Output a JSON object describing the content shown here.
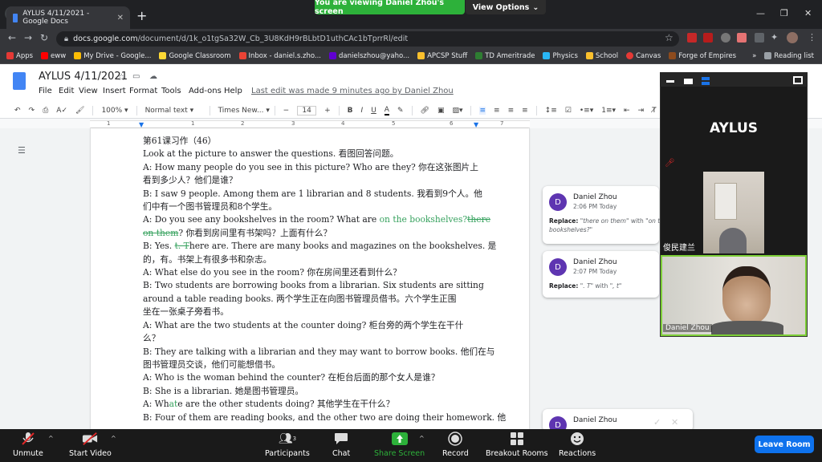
{
  "browser": {
    "tab_title": "AYLUS 4/11/2021 - Google Docs",
    "url_domain": "docs.google.com",
    "url_path": "/document/d/1k_o1tgSa32W_Cb_3U8KdH9rBLbtD1uthCAc1bTprrRl/edit",
    "bookmarks": [
      "Apps",
      "eww",
      "My Drive - Google...",
      "Google Classroom",
      "Inbox - daniel.s.zho...",
      "danielszhou@yaho...",
      "APCSP Stuff",
      "TD Ameritrade",
      "Physics",
      "School",
      "Canvas",
      "Forge of Empires"
    ],
    "reading_list": "Reading list",
    "more": "»"
  },
  "zoom_banner": {
    "viewing": "You are viewing Daniel Zhou's screen",
    "view_options": "View Options"
  },
  "docs": {
    "title": "AYLUS 4/11/2021",
    "menus": [
      "File",
      "Edit",
      "View",
      "Insert",
      "Format",
      "Tools",
      "Add-ons",
      "Help"
    ],
    "last_edit": "Last edit was made 9 minutes ago by Daniel Zhou",
    "toolbar": {
      "zoom": "100%",
      "style": "Normal text",
      "font": "Times New...",
      "size": "14",
      "minus": "−",
      "plus": "+",
      "bold": "B",
      "italic": "I",
      "underline": "U",
      "textcolor": "A"
    },
    "ruler_numbers": [
      "1",
      "1",
      "2",
      "3",
      "4",
      "5",
      "6",
      "7"
    ]
  },
  "document": {
    "line1": "第61课习作（46）",
    "line2": "Look at the picture to answer the questions. 看图回答问题。",
    "line3": "A: How many people do you see in this picture? Who are they? 你在这张图片上",
    "line4": "看到多少人？他们是谁？",
    "line5": "B: I saw 9 people. Among them are 1 librarian and 8 students. 我看到9个人。他",
    "line6": "们中有一个图书管理员和8个学生。",
    "line7a": "A: Do you see any bookshelves in the room? What are ",
    "line7b": "on the bookshelves?",
    "line7c": "there",
    "line8a": "on them",
    "line8b": "? 你看到房间里有书架吗？上面有什么？",
    "line9a": "B: Yes. ",
    "line9b": "t. T",
    "line9c": "here are. There are many books and magazines on the bookshelves. 是",
    "line10": "的，有。书架上有很多书和杂志。",
    "line11": "A: What else do you see in the room? 你在房间里还看到什么？",
    "line12": "B: Two students are borrowing books from a librarian. Six students are sitting",
    "line13": "around a table reading books. 两个学生正在向图书管理员借书。六个学生正围",
    "line14": "坐在一张桌子旁看书。",
    "line15": "A: What are the two students at the counter doing? 柜台旁的两个学生在干什",
    "line16": "么？",
    "line17": "B: They are talking with a librarian and they may want to borrow books. 他们在与",
    "line18": "图书管理员交谈，他们可能想借书。",
    "line19": "A: Who is the woman behind the counter? 在柜台后面的那个女人是谁？",
    "line20": "B: She is a librarian. 她是图书管理员。",
    "line21a": "A: Wh",
    "line21b": "at",
    "line21c": "e are the other students doing? 其他学生在干什么？",
    "line22": "B: Four of them are reading books, and the other two are doing their homework. 他"
  },
  "comments": [
    {
      "avatar": "D",
      "name": "Daniel Zhou",
      "time": "2:06 PM Today",
      "replace_label": "Replace:",
      "from": "\"there on them\"",
      "with_word": " with ",
      "to": "\"on the bookshelves?\""
    },
    {
      "avatar": "D",
      "name": "Daniel Zhou",
      "time": "2:07 PM Today",
      "replace_label": "Replace:",
      "from": "\". T\"",
      "with_word": " with ",
      "to": "\", t\""
    },
    {
      "avatar": "D",
      "name": "Daniel Zhou"
    }
  ],
  "video": {
    "tile1_name": "AYLUS",
    "tile2_name": "俊民建兰",
    "tile3_name": "Daniel Zhou"
  },
  "zoom_bar": {
    "unmute": "Unmute",
    "start_video": "Start Video",
    "participants": "Participants",
    "participants_count": "3",
    "chat": "Chat",
    "share_screen": "Share Screen",
    "record": "Record",
    "breakout": "Breakout Rooms",
    "reactions": "Reactions",
    "leave": "Leave Room"
  },
  "colors": {
    "zoom_green": "#2db13a",
    "suggestion_green": "#35a15d",
    "leave_blue": "#0e72ed",
    "avatar_purple": "#5e35b1"
  }
}
